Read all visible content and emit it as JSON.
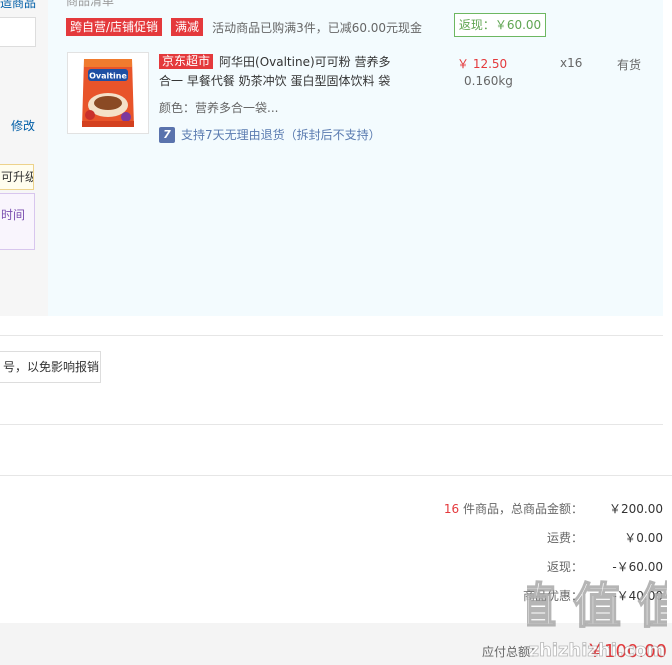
{
  "left_column": {
    "top_link_partial": "造商品",
    "edit_link": "修改",
    "upgrade_tip": "可升级",
    "box_text": "时间"
  },
  "order": {
    "top_cut_text": "商品清单",
    "promo": {
      "tag_cross": "跨自营/店铺促销",
      "tag_full_reduce": "满减",
      "text": "活动商品已购满3件，已减60.00元现金",
      "rebate_box": "返现：￥60.00"
    },
    "product": {
      "jd_tag": "京东超市",
      "title": "阿华田(Ovaltine)可可粉 营养多合一 早餐代餐 奶茶冲饮 蛋白型固体饮料 袋",
      "attribute": "颜色：营养多合一袋...",
      "return_icon": "7",
      "return_text": "支持7天无理由退货（拆封后不支持）",
      "price": "￥ 12.50",
      "weight": "0.160kg",
      "quantity": "x16",
      "stock": "有货",
      "image_brand": "Ovaltine"
    }
  },
  "invoice": {
    "tip": "号，以免影响报销"
  },
  "summary": {
    "count": "16",
    "count_suffix": " 件商品，总商品金额：",
    "total_amount": "￥200.00",
    "shipping_label": "运费：",
    "shipping": "￥0.00",
    "rebate_label": "返现：",
    "rebate": "-￥60.00",
    "discount_label": "商品优惠：",
    "discount": "-￥40.00",
    "pay_label": "应付总额：",
    "pay_total": "￥100.00"
  },
  "watermark": {
    "text": "值 值 值",
    "site": "zhizhizhi.com"
  },
  "colors": {
    "accent_red": "#e4393c",
    "link_blue": "#005ea7",
    "rebate_green": "#5fa552",
    "panel_blue": "#f3fbfe"
  }
}
